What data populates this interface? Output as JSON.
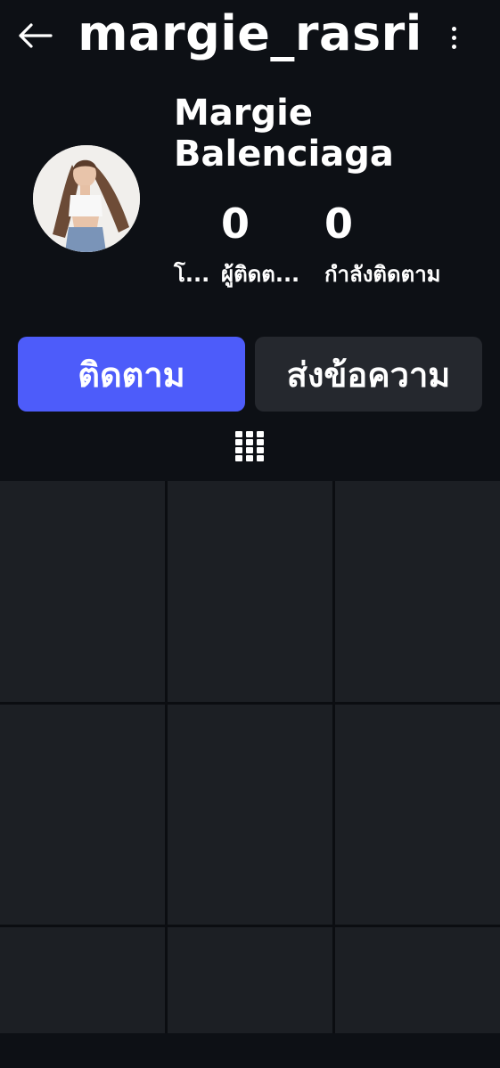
{
  "header": {
    "username": "margie_rasri",
    "back_icon": "arrow-left-icon",
    "more_icon": "more-vertical-icon"
  },
  "profile": {
    "display_name_line1": "Margie",
    "display_name_line2": "Balenciaga",
    "avatar_icon": "profile-photo"
  },
  "stats": [
    {
      "count": "",
      "label": "โ..."
    },
    {
      "count": "0",
      "label": "ผู้ติดต..."
    },
    {
      "count": "0",
      "label": "กำลังติดตาม"
    }
  ],
  "actions": {
    "follow_label": "ติดตาม",
    "message_label": "ส่งข้อความ"
  },
  "tabs": {
    "grid_icon": "grid-icon"
  },
  "colors": {
    "background": "#0d1015",
    "accent": "#4d5cfa",
    "secondary_button": "#25282e",
    "placeholder_cell": "#1c1f24"
  }
}
